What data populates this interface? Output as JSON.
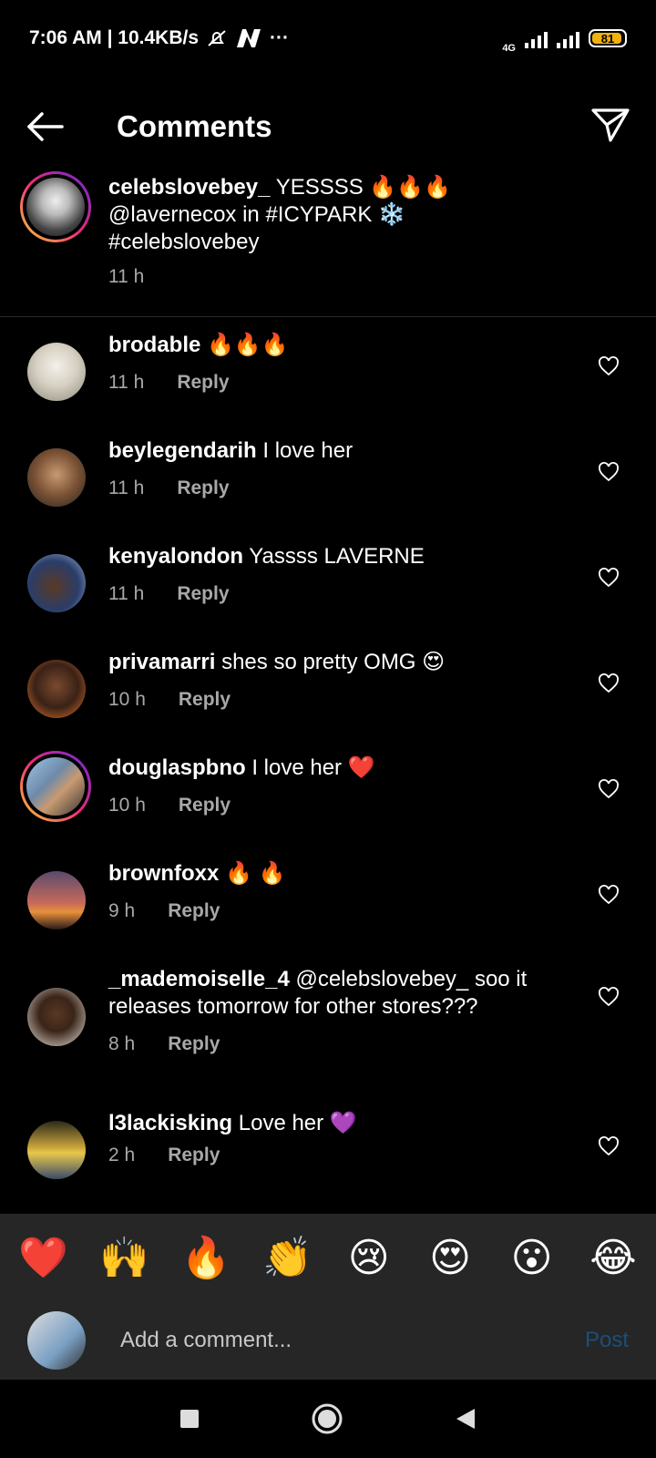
{
  "status_bar": {
    "time_text": "7:06 AM | 10.4KB/s",
    "overflow": "···",
    "network": "4G",
    "battery": "81"
  },
  "header": {
    "title": "Comments"
  },
  "caption": {
    "username": "celebslovebey_",
    "text": "YESSSS 🔥🔥🔥",
    "line2": "@lavernecox in #ICYPARK ❄️",
    "line3": "#celebslovebey",
    "time": "11 h"
  },
  "comments": [
    {
      "username": "brodable",
      "text": "🔥🔥🔥",
      "time": "11 h",
      "reply": "Reply"
    },
    {
      "username": "beylegendarih",
      "text": "I love her",
      "time": "11 h",
      "reply": "Reply"
    },
    {
      "username": "kenyalondon",
      "text": "Yassss LAVERNE",
      "time": "11 h",
      "reply": "Reply"
    },
    {
      "username": "privamarri",
      "text": "shes so pretty OMG 😍",
      "time": "10 h",
      "reply": "Reply"
    },
    {
      "username": "douglaspbno",
      "text": "I love her ❤️",
      "time": "10 h",
      "reply": "Reply"
    },
    {
      "username": "brownfoxx",
      "text": "🔥 🔥",
      "time": "9 h",
      "reply": "Reply"
    },
    {
      "username": "_mademoiselle_4",
      "text": "@celebslovebey_  soo it",
      "text2": "releases tomorrow for other stores???",
      "time": "8 h",
      "reply": "Reply"
    },
    {
      "username": "l3lackisking",
      "text": "Love her 💜",
      "time": "2 h",
      "reply": "Reply"
    }
  ],
  "emoji_bar": [
    "❤️",
    "🙌",
    "🔥",
    "👏",
    "😢",
    "😍",
    "😮",
    "😂"
  ],
  "compose": {
    "placeholder": "Add a comment...",
    "post_label": "Post"
  },
  "colors": {
    "background": "#000000",
    "secondary_text": "#a8a8a8",
    "composer_bg": "#262626",
    "post_disabled": "#1b4f7a",
    "battery": "#f2b20b"
  }
}
